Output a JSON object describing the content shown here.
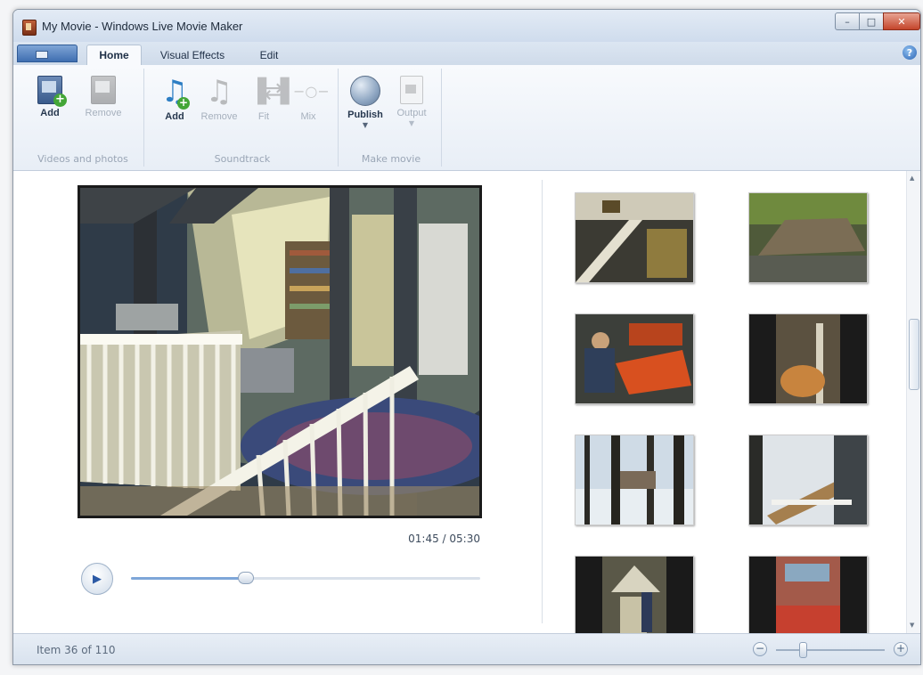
{
  "window": {
    "title": "My Movie - Windows Live Movie Maker"
  },
  "tabs": [
    {
      "label": "Home",
      "active": true
    },
    {
      "label": "Visual Effects",
      "active": false
    },
    {
      "label": "Edit",
      "active": false
    }
  ],
  "ribbon": {
    "videos_group": {
      "label": "Videos and photos",
      "buttons": [
        {
          "label": "Add",
          "icon": "add-video-icon",
          "enabled": true
        },
        {
          "label": "Remove",
          "icon": "remove-video-icon",
          "enabled": false
        }
      ]
    },
    "soundtrack_group": {
      "label": "Soundtrack",
      "buttons": [
        {
          "label": "Add",
          "icon": "add-music-icon",
          "enabled": true
        },
        {
          "label": "Remove",
          "icon": "remove-music-icon",
          "enabled": false
        },
        {
          "label": "Fit",
          "icon": "fit-icon",
          "enabled": false
        },
        {
          "label": "Mix",
          "icon": "mix-icon",
          "enabled": false
        }
      ]
    },
    "make_group": {
      "label": "Make movie",
      "buttons": [
        {
          "label": "Publish",
          "icon": "publish-globe-icon",
          "enabled": true
        },
        {
          "label": "Output",
          "icon": "output-icon",
          "enabled": false
        }
      ]
    }
  },
  "player": {
    "timecode": "01:45 / 05:30",
    "progress_fraction": 0.33
  },
  "thumbnails": [
    {
      "name": "workshop-beams"
    },
    {
      "name": "log-pile"
    },
    {
      "name": "sawmill-worker"
    },
    {
      "name": "dog-in-woods"
    },
    {
      "name": "winter-trees"
    },
    {
      "name": "snowy-deck"
    },
    {
      "name": "cabin-doorway"
    },
    {
      "name": "red-shed"
    }
  ],
  "status": {
    "item_text": "Item 36 of 110",
    "zoom_fraction": 0.25
  },
  "colors": {
    "accent": "#2c5aa5",
    "ribbon_bg": "#f8fafd",
    "close_button": "#c4452b"
  }
}
